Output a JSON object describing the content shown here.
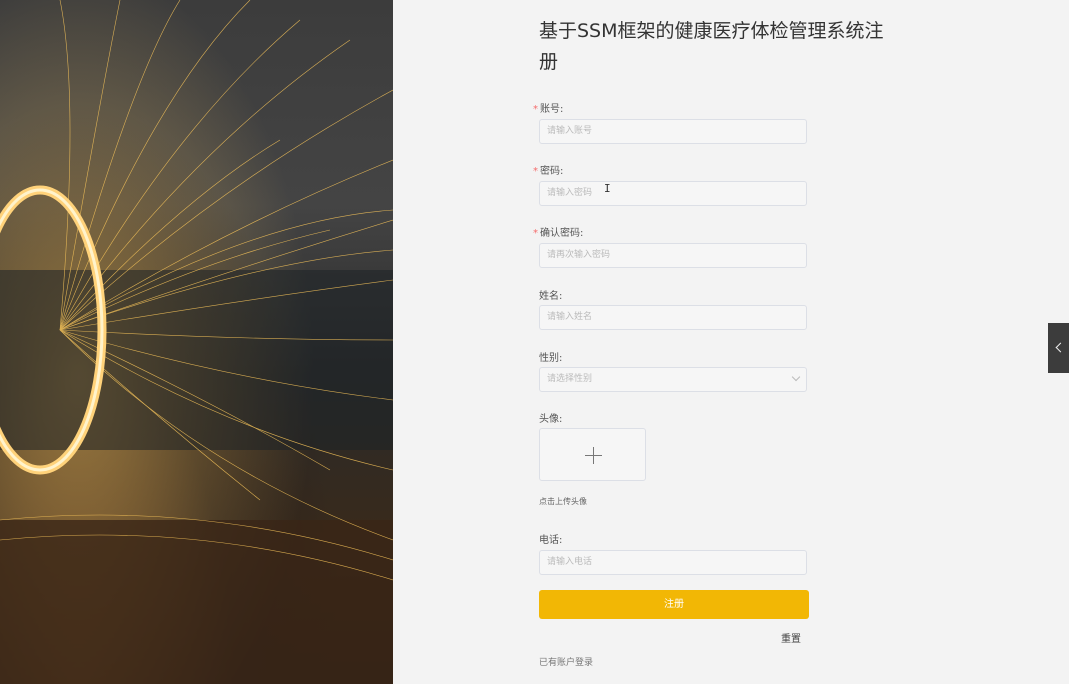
{
  "title": "基于SSM框架的健康医疗体检管理系统注册",
  "fields": {
    "account": {
      "label": "账号:",
      "placeholder": "请输入账号",
      "required": true
    },
    "password": {
      "label": "密码:",
      "placeholder": "请输入密码",
      "required": true
    },
    "confirm": {
      "label": "确认密码:",
      "placeholder": "请再次输入密码",
      "required": true
    },
    "name": {
      "label": "姓名:",
      "placeholder": "请输入姓名",
      "required": false
    },
    "gender": {
      "label": "性别:",
      "placeholder": "请选择性别",
      "required": false
    },
    "avatar": {
      "label": "头像:",
      "hint": "点击上传头像",
      "icon": "plus-icon"
    },
    "phone": {
      "label": "电话:",
      "placeholder": "请输入电话",
      "required": false
    }
  },
  "required_mark": "*",
  "buttons": {
    "register": "注册",
    "reset": "重置",
    "login_link": "已有账户登录"
  },
  "colors": {
    "accent": "#f2b705",
    "required": "#f56c6c"
  },
  "side_tab": {
    "icon": "chevron-left-icon"
  }
}
